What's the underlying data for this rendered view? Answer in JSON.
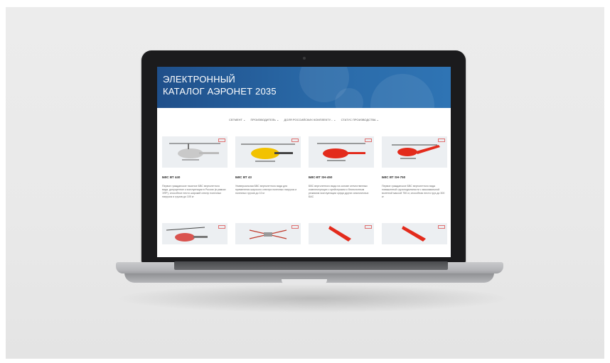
{
  "hero": {
    "title_line1": "ЭЛЕКТРОННЫЙ",
    "title_line2": "КАТАЛОГ АЭРОНЕТ 2035"
  },
  "nav": {
    "items": [
      "СЕГМЕНТ ⌄",
      "ПРОИЗВОДИТЕЛЬ ⌄",
      "ДОЛЯ РОССИЙСКИХ КОМПЛЕКТУ... ⌄",
      "СТАТУС ПРОИЗВОДСТВА ⌄"
    ]
  },
  "cards": [
    {
      "name": "БВС ВТ 440",
      "desc": "Первое гражданское тяжелое БВС вертолетного вида, допущенное к эксплуатации в России (в рамках ЭПР), способное нести широкий спектр полезных нагрузок и грузов до 100 кг",
      "color": "#bdbdbd"
    },
    {
      "name": "БВС ВТ 43",
      "desc": "Универсальная БВС вертолетного вида для применения широкого спектра полезных нагрузок и полезных грузов до 10 кг",
      "color": "#f2c200"
    },
    {
      "name": "БВС-ВТ SH-450",
      "desc": "БВС вертолетного вида на основе отечественных комплектующих с крейсерским и беспилотным режимом эксплуатации среди других аналогичных БАС",
      "color": "#e32b1c"
    },
    {
      "name": "БВС ВТ SH-750",
      "desc": "Первое гражданское БВС вертолетного вида повышенной грузоподъемности с максимальной взлетной массой 750 кг, способная нести груз до 300 кг",
      "color": "#e32b1c"
    }
  ],
  "colors": {
    "hero_start": "#1f4f8a",
    "hero_end": "#2f74b4",
    "accent_red": "#e32b1c",
    "accent_yellow": "#f2c200"
  }
}
